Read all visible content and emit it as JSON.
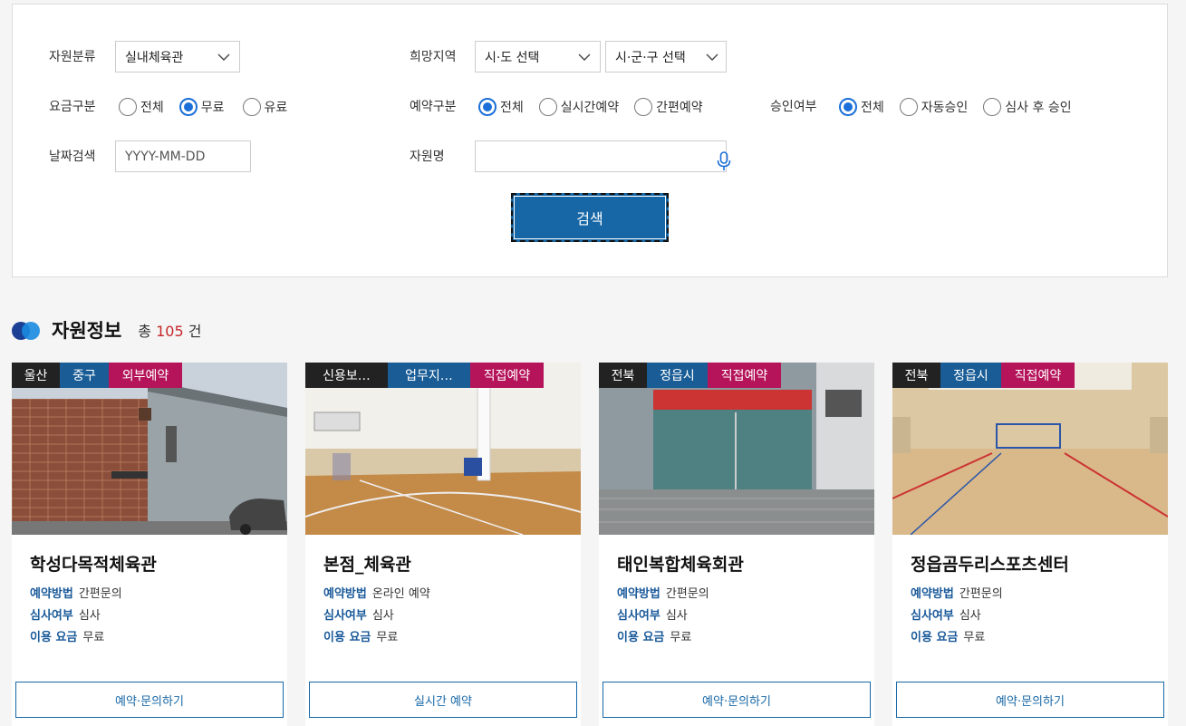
{
  "filters": {
    "resource_type": {
      "label": "자원분류",
      "selected": "실내체육관"
    },
    "region": {
      "label": "희망지역",
      "sido": "시·도 선택",
      "sigungu": "시·군·구 선택"
    },
    "fee": {
      "label": "요금구분",
      "options": [
        "전체",
        "무료",
        "유료"
      ],
      "selected_index": 1
    },
    "reservation": {
      "label": "예약구분",
      "options": [
        "전체",
        "실시간예약",
        "간편예약"
      ],
      "selected_index": 0
    },
    "approval": {
      "label": "승인여부",
      "options": [
        "전체",
        "자동승인",
        "심사 후 승인"
      ],
      "selected_index": 0
    },
    "date": {
      "label": "날짜검색",
      "placeholder": "YYYY-MM-DD"
    },
    "resource_name": {
      "label": "자원명",
      "value": ""
    },
    "search_label": "검색"
  },
  "section": {
    "title": "자원정보",
    "count_prefix": "총",
    "count": "105",
    "count_suffix": "건"
  },
  "colors": {
    "accent": "#1767a6",
    "tag_dark": "#222222",
    "tag_blue": "#1a5d96",
    "tag_magenta": "#b5145a",
    "count_red": "#c6282b"
  },
  "cards": [
    {
      "tags": [
        "울산",
        "중구",
        "외부예약"
      ],
      "title": "학성다목적체육관",
      "method_label": "예약방법",
      "method": "간편문의",
      "review_label": "심사여부",
      "review": "심사",
      "fee_label": "이용 요금",
      "fee": "무료",
      "button": "예약·문의하기"
    },
    {
      "tags": [
        "신용보…",
        "업무지…",
        "직접예약"
      ],
      "title": "본점_체육관",
      "method_label": "예약방법",
      "method": "온라인 예약",
      "review_label": "심사여부",
      "review": "심사",
      "fee_label": "이용 요금",
      "fee": "무료",
      "button": "실시간 예약"
    },
    {
      "tags": [
        "전북",
        "정읍시",
        "직접예약"
      ],
      "title": "태인복합체육회관",
      "method_label": "예약방법",
      "method": "간편문의",
      "review_label": "심사여부",
      "review": "심사",
      "fee_label": "이용 요금",
      "fee": "무료",
      "button": "예약·문의하기"
    },
    {
      "tags": [
        "전북",
        "정읍시",
        "직접예약"
      ],
      "title": "정읍곰두리스포츠센터",
      "method_label": "예약방법",
      "method": "간편문의",
      "review_label": "심사여부",
      "review": "심사",
      "fee_label": "이용 요금",
      "fee": "무료",
      "button": "예약·문의하기"
    }
  ]
}
